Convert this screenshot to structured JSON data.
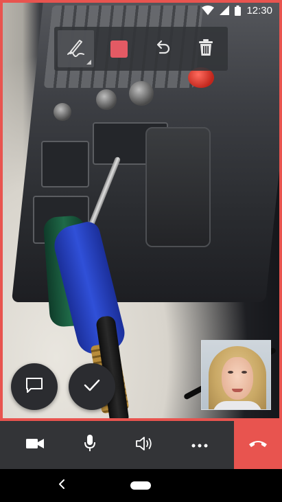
{
  "status_bar": {
    "time": "12:30",
    "icons": [
      "wifi-icon",
      "signal-icon",
      "battery-icon"
    ]
  },
  "draw_toolbar": {
    "tools": [
      {
        "name": "pen-tool",
        "icon": "pen-signature-icon",
        "active": true
      },
      {
        "name": "color-picker",
        "icon": "color-swatch",
        "color": "#e35a64"
      },
      {
        "name": "undo",
        "icon": "undo-icon"
      },
      {
        "name": "clear",
        "icon": "trash-icon"
      }
    ]
  },
  "floating_actions": [
    {
      "name": "chat",
      "icon": "chat-bubble-icon"
    },
    {
      "name": "confirm",
      "icon": "checkmark-icon"
    }
  ],
  "call_controls": [
    {
      "name": "video",
      "icon": "video-camera-icon"
    },
    {
      "name": "microphone",
      "icon": "microphone-icon"
    },
    {
      "name": "speaker",
      "icon": "speaker-volume-icon"
    },
    {
      "name": "more",
      "icon": "more-dots-icon"
    }
  ],
  "hangup": {
    "icon": "phone-hangup-icon",
    "color": "#e8544f"
  },
  "colors": {
    "frame": "#e8544f",
    "toolbar_bg": "#333437",
    "fab_bg": "#2b2c30",
    "swatch": "#e35a64"
  },
  "system_nav": {
    "icons": [
      "back-chevron-icon",
      "home-pill-icon"
    ]
  }
}
